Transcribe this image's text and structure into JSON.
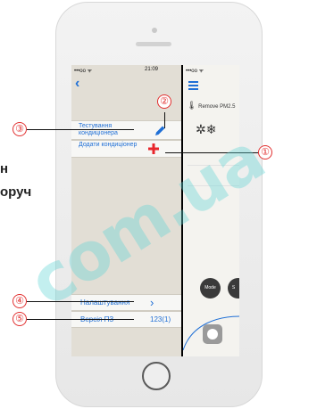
{
  "status_bar": {
    "carrier": "•••oo ᯤ",
    "time": "21:09",
    "carrier_right": "•••oo ᯤ"
  },
  "left_menu": {
    "back_icon": "chevron-left-icon",
    "items": [
      {
        "label": "Тестування кондиціонера",
        "action_icon": "pencil-icon"
      },
      {
        "label": "Додати кондиціонер",
        "action_icon": "plus-icon"
      },
      {
        "label": "Налаштування",
        "action_icon": "chevron-right-icon"
      },
      {
        "label": "Версія ПЗ",
        "value": "123(1)"
      }
    ]
  },
  "right_preview": {
    "menu_icon": "hamburger-icon",
    "remove_text": "Remove PM2.5",
    "mode_button": "Mode",
    "partial_button": "S"
  },
  "callouts": [
    "①",
    "②",
    "③",
    "④",
    "⑤"
  ],
  "side_text": [
    "н",
    "оруч"
  ],
  "watermark": "com.ua",
  "colors": {
    "accent": "#1f6fd6",
    "callout": "#e23030",
    "plus": "#e8262b",
    "watermark": "#60d6d6"
  }
}
